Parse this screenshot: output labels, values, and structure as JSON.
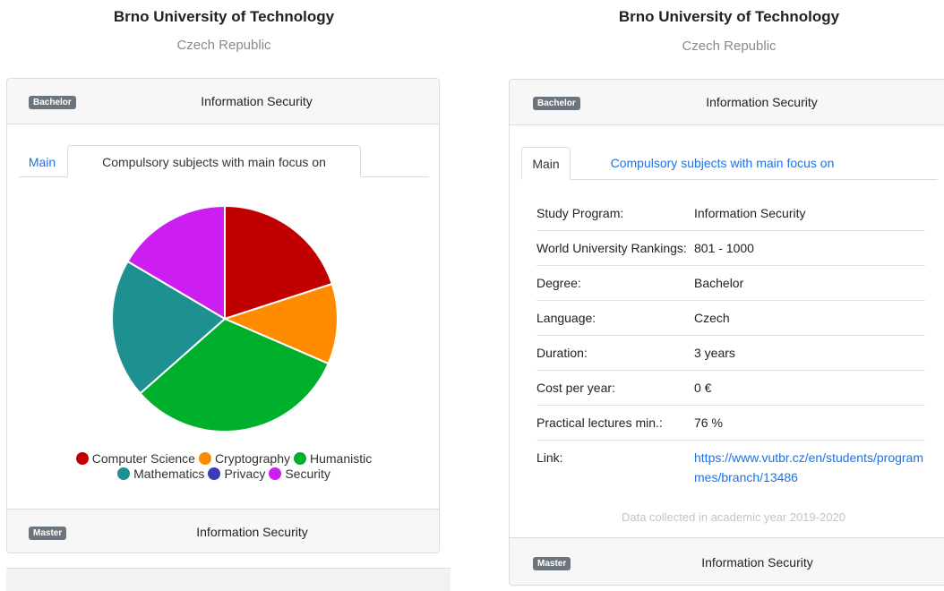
{
  "left": {
    "university": "Brno University of Technology",
    "country": "Czech Republic",
    "bachelor_badge": "Bachelor",
    "program": "Information Security",
    "tabs": [
      "Main",
      "Compulsory subjects with main focus on"
    ],
    "master_badge": "Master",
    "master_program": "Information Security"
  },
  "right": {
    "university": "Brno University of Technology",
    "country": "Czech Republic",
    "bachelor_badge": "Bachelor",
    "program": "Information Security",
    "tabs": [
      "Main",
      "Compulsory subjects with main focus on"
    ],
    "rows": [
      {
        "key": "Study Program:",
        "value": "Information Security"
      },
      {
        "key": "World University Rankings:",
        "value": "801 - 1000"
      },
      {
        "key": "Degree:",
        "value": "Bachelor"
      },
      {
        "key": "Language:",
        "value": "Czech"
      },
      {
        "key": "Duration:",
        "value": "3 years"
      },
      {
        "key": "Cost per year:",
        "value": "0 €"
      },
      {
        "key": "Practical lectures min.:",
        "value": "76 %"
      },
      {
        "key": "Link:",
        "value": "https://www.vutbr.cz/en/students/programmes/branch/13486",
        "link": true
      }
    ],
    "collected": "Data collected in academic year 2019-2020",
    "master_badge": "Master",
    "master_program": "Information Security"
  },
  "chart_data": {
    "type": "pie",
    "title": "",
    "categories": [
      "Computer Science",
      "Cryptography",
      "Humanistic",
      "Mathematics",
      "Privacy",
      "Security"
    ],
    "values": [
      20,
      11.5,
      32,
      20,
      0,
      16.5
    ],
    "colors": [
      "#c00000",
      "#ff8c00",
      "#00b02c",
      "#1e9090",
      "#3a3aba",
      "#cc1ef0"
    ],
    "legend_position": "bottom"
  }
}
